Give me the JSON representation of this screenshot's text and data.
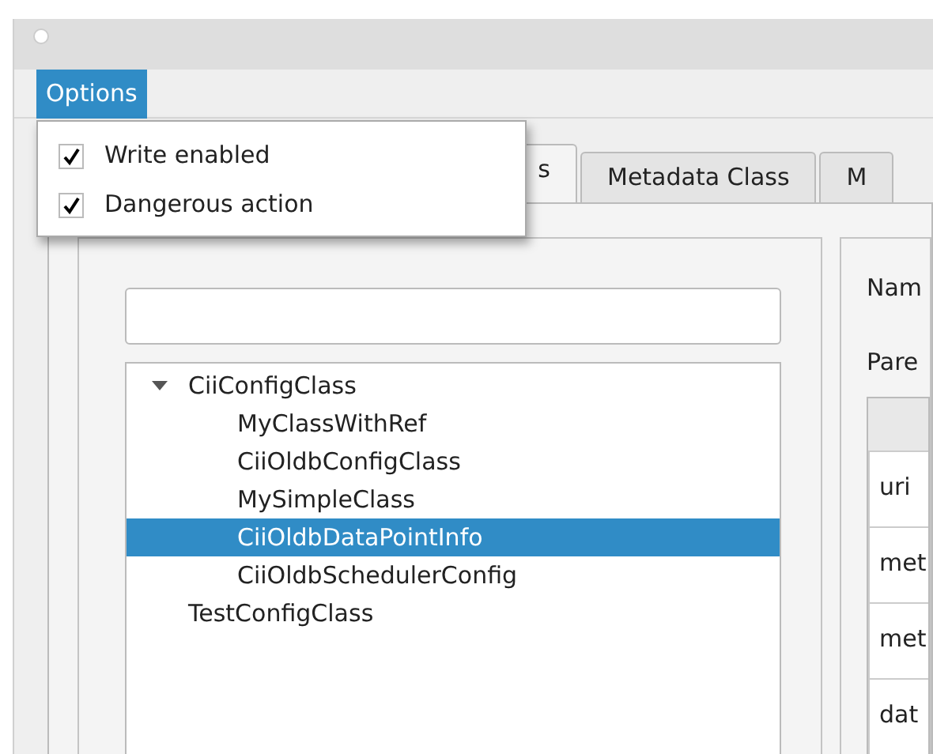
{
  "menubar": [
    {
      "label": "Options",
      "selected": true
    }
  ],
  "options_menu": [
    {
      "label": "Write enabled",
      "checked": true
    },
    {
      "label": "Dangerous action",
      "checked": true
    }
  ],
  "tabs": [
    {
      "label": "s",
      "selected": true
    },
    {
      "label": "Metadata Class",
      "selected": false
    },
    {
      "label": "M",
      "selected": false
    }
  ],
  "tree": [
    {
      "label": "CiiConfigClass",
      "expanded": true,
      "selected": false,
      "children": [
        {
          "label": "MyClassWithRef",
          "selected": false
        },
        {
          "label": "CiiOldbConfigClass",
          "selected": false
        },
        {
          "label": "MySimpleClass",
          "selected": false
        },
        {
          "label": "CiiOldbDataPointInfo",
          "selected": true
        },
        {
          "label": "CiiOldbSchedulerConfig",
          "selected": false
        }
      ]
    },
    {
      "label": "TestConfigClass",
      "selected": false
    }
  ],
  "details": {
    "labels": [
      "Nam",
      "Pare"
    ],
    "table": {
      "rows": [
        "uri",
        "met",
        "met",
        "dat"
      ]
    }
  }
}
